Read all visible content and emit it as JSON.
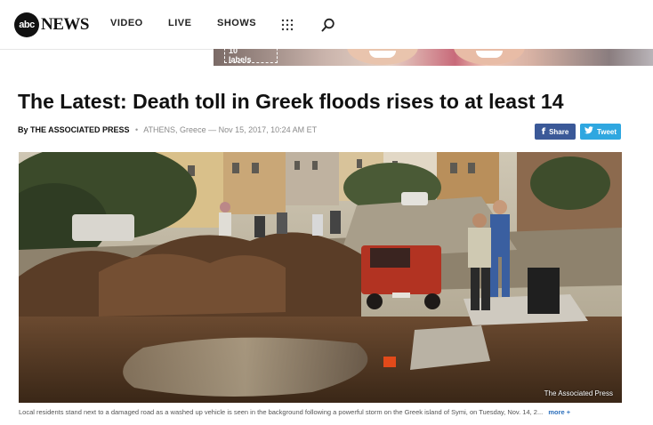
{
  "header": {
    "logo": {
      "mark": "abc",
      "word": "NEWS"
    },
    "nav": [
      {
        "label": "VIDEO"
      },
      {
        "label": "LIVE"
      },
      {
        "label": "SHOWS"
      }
    ],
    "icons": [
      "grid-icon",
      "search-icon"
    ]
  },
  "banner": {
    "badge": "10\nlabels"
  },
  "article": {
    "headline": "The Latest: Death toll in Greek floods rises to at least 14",
    "byline": {
      "author": "By THE ASSOCIATED PRESS",
      "separator": "•",
      "dateline": "ATHENS, Greece — Nov 15, 2017, 10:24 AM ET"
    },
    "share": {
      "facebook": "Share",
      "twitter": "Tweet"
    },
    "photo": {
      "credit": "The Associated Press",
      "caption": "Local residents stand next to a damaged road as a washed up vehicle is seen in the background following a powerful storm on the Greek island of Symi, on Tuesday, Nov. 14, 2...",
      "more": "more +"
    }
  },
  "colors": {
    "facebook": "#3b5998",
    "twitter": "#2fa7e0",
    "link": "#2a6ebb"
  }
}
